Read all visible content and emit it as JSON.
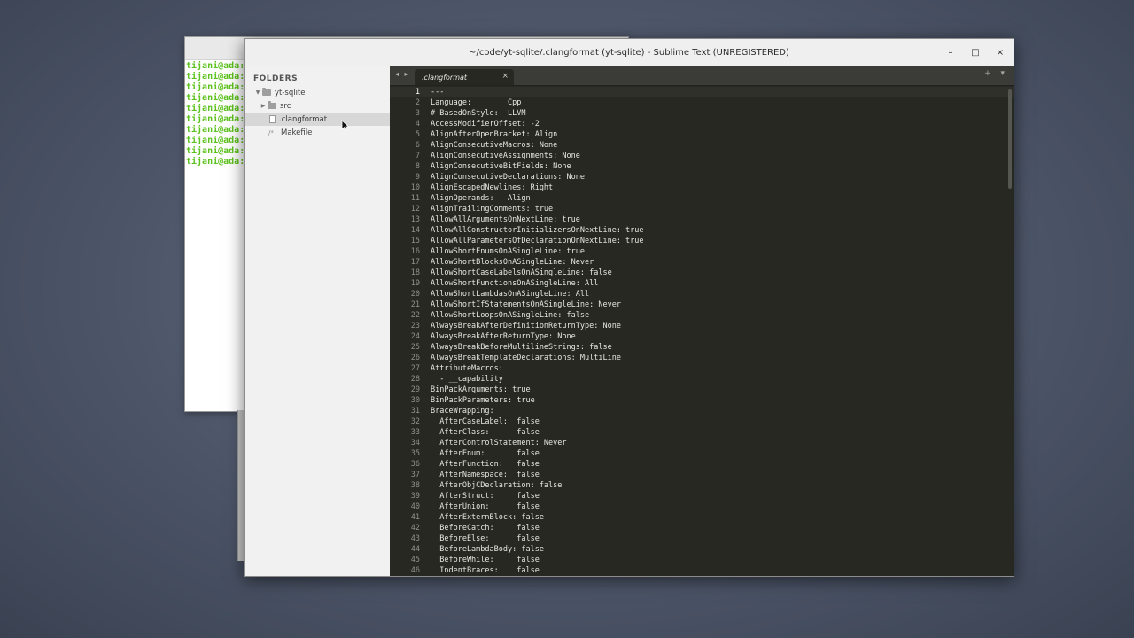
{
  "terminal": {
    "lines": [
      "tijani@ada:",
      "tijani@ada:",
      "tijani@ada:",
      "tijani@ada:",
      "tijani@ada:",
      "tijani@ada:",
      "tijani@ada:",
      "tijani@ada:",
      "tijani@ada:",
      "tijani@ada:"
    ]
  },
  "window": {
    "title": "~/code/yt-sqlite/.clangformat (yt-sqlite) - Sublime Text (UNREGISTERED)",
    "minimize_label": "–",
    "maximize_label": "□",
    "close_label": "×"
  },
  "sidebar": {
    "header": "FOLDERS",
    "project": "yt-sqlite",
    "items": [
      {
        "label": "src"
      },
      {
        "label": ".clangformat"
      },
      {
        "label": "Makefile"
      }
    ]
  },
  "tabs": {
    "nav": "◂ ▸",
    "active": ".clangformat",
    "close": "×",
    "right_controls": "+ ▾"
  },
  "editor": {
    "lines": [
      "---",
      "Language:        Cpp",
      "# BasedOnStyle:  LLVM",
      "AccessModifierOffset: -2",
      "AlignAfterOpenBracket: Align",
      "AlignConsecutiveMacros: None",
      "AlignConsecutiveAssignments: None",
      "AlignConsecutiveBitFields: None",
      "AlignConsecutiveDeclarations: None",
      "AlignEscapedNewlines: Right",
      "AlignOperands:   Align",
      "AlignTrailingComments: true",
      "AllowAllArgumentsOnNextLine: true",
      "AllowAllConstructorInitializersOnNextLine: true",
      "AllowAllParametersOfDeclarationOnNextLine: true",
      "AllowShortEnumsOnASingleLine: true",
      "AllowShortBlocksOnASingleLine: Never",
      "AllowShortCaseLabelsOnASingleLine: false",
      "AllowShortFunctionsOnASingleLine: All",
      "AllowShortLambdasOnASingleLine: All",
      "AllowShortIfStatementsOnASingleLine: Never",
      "AllowShortLoopsOnASingleLine: false",
      "AlwaysBreakAfterDefinitionReturnType: None",
      "AlwaysBreakAfterReturnType: None",
      "AlwaysBreakBeforeMultilineStrings: false",
      "AlwaysBreakTemplateDeclarations: MultiLine",
      "AttributeMacros:",
      "  - __capability",
      "BinPackArguments: true",
      "BinPackParameters: true",
      "BraceWrapping:",
      "  AfterCaseLabel:  false",
      "  AfterClass:      false",
      "  AfterControlStatement: Never",
      "  AfterEnum:       false",
      "  AfterFunction:   false",
      "  AfterNamespace:  false",
      "  AfterObjCDeclaration: false",
      "  AfterStruct:     false",
      "  AfterUnion:      false",
      "  AfterExternBlock: false",
      "  BeforeCatch:     false",
      "  BeforeElse:      false",
      "  BeforeLambdaBody: false",
      "  BeforeWhile:     false",
      "  IndentBraces:    false"
    ]
  }
}
